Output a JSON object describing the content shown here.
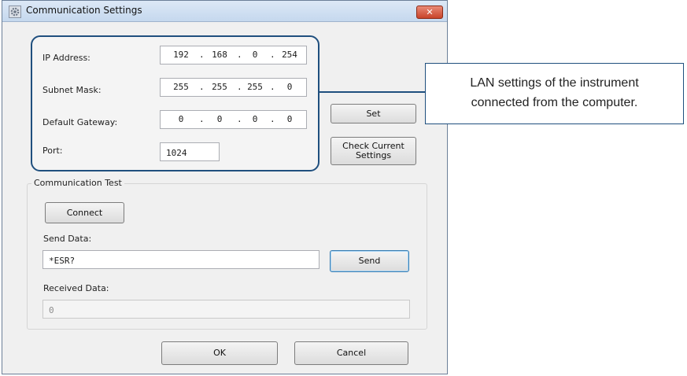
{
  "window": {
    "title": "Communication Settings",
    "close_label": "✕"
  },
  "ip_address": {
    "label": "IP Address:",
    "octets": [
      "192",
      "168",
      "0",
      "254"
    ]
  },
  "subnet_mask": {
    "label": "Subnet Mask:",
    "octets": [
      "255",
      "255",
      "255",
      "0"
    ]
  },
  "default_gateway": {
    "label": "Default Gateway:",
    "octets": [
      "0",
      "0",
      "0",
      "0"
    ]
  },
  "port": {
    "label": "Port:",
    "value": "1024"
  },
  "buttons": {
    "set": "Set",
    "check_line1": "Check Current",
    "check_line2": "Settings",
    "connect": "Connect",
    "send": "Send",
    "ok": "OK",
    "cancel": "Cancel"
  },
  "communication_test": {
    "title": "Communication Test",
    "send_data_label": "Send Data:",
    "send_data_value": "*ESR?",
    "received_data_label": "Received Data:",
    "received_data_value": "0"
  },
  "callout": {
    "line1": "LAN settings of the instrument",
    "line2": "connected from the computer."
  },
  "colors": {
    "highlight_border": "#1f4f7e",
    "close_button": "#c8442a",
    "title_bar": "#c5d8ee"
  },
  "icons": {
    "title_icon": "gear-icon"
  }
}
